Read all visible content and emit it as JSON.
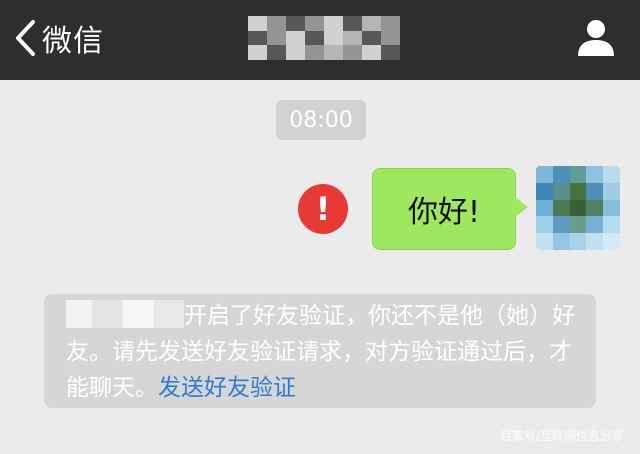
{
  "header": {
    "back_label": "微信",
    "title": "",
    "icons": {
      "back": "chevron-left-icon",
      "profile": "person-icon"
    }
  },
  "chat": {
    "timestamp": "08:00",
    "message": {
      "text": "你好!",
      "status": "send-failed",
      "status_icon": "exclamation-icon",
      "status_color": "#e83a35",
      "bubble_color": "#9fe75e"
    },
    "system_notice": {
      "text": "开启了好友验证，你还不是他（她）好友。请先发送好友验证请求，对方验证通过后，才能聊天。",
      "link_text": "发送好友验证",
      "link_color": "#2f7bd3"
    }
  },
  "watermark": "百家号/互联网信息分享",
  "colors": {
    "nav_bg": "#2e2e2e",
    "chat_bg": "#ebebeb"
  }
}
